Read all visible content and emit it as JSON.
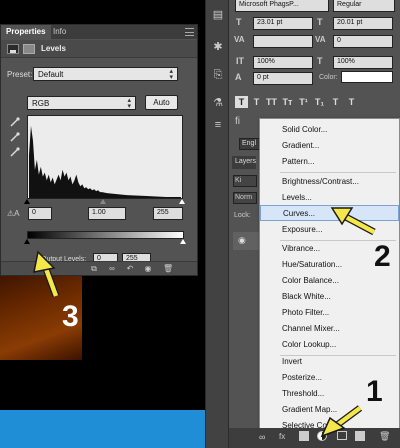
{
  "properties_panel": {
    "tabs": [
      "Properties",
      "Info"
    ],
    "adjustment_title": "Levels",
    "preset_label": "Preset:",
    "preset_value": "Default",
    "channel_value": "RGB",
    "auto_label": "Auto",
    "input_black": "0",
    "input_gamma": "1.00",
    "input_white": "255",
    "output_label": "Output Levels:",
    "output_black": "0",
    "output_white": "255"
  },
  "character_panel": {
    "font_family": "Microsoft PhagsP...",
    "font_style": "Regular",
    "font_size": "23.01 pt",
    "leading": "20.01 pt",
    "kerning": "",
    "tracking": "0",
    "vertical_scale": "100%",
    "horizontal_scale": "100%",
    "baseline_shift": "0 pt",
    "color_label": "Color:",
    "language": "Engl"
  },
  "layers_panel": {
    "tab": "Layers",
    "kind_placeholder": "Ki",
    "blend_mode": "Norm",
    "lock_label": "Lock:"
  },
  "adjustment_menu": {
    "items": [
      "Solid Color...",
      "Gradient...",
      "Pattern...",
      "Brightness/Contrast...",
      "Levels...",
      "Curves...",
      "Exposure...",
      "Vibrance...",
      "Hue/Saturation...",
      "Color Balance...",
      "Black  White...",
      "Photo Filter...",
      "Channel Mixer...",
      "Color Lookup...",
      "Invert",
      "Posterize...",
      "Threshold...",
      "Gradient Map...",
      "Selective Co..."
    ],
    "highlighted": "Curves..."
  },
  "annotations": {
    "step1": "1",
    "step2": "2",
    "step3": "3"
  },
  "colors": {
    "arrow": "#f5e64a",
    "panel": "#535353",
    "menu_highlight": "#d6e6f8",
    "blue_strip": "#1f8ed6"
  }
}
